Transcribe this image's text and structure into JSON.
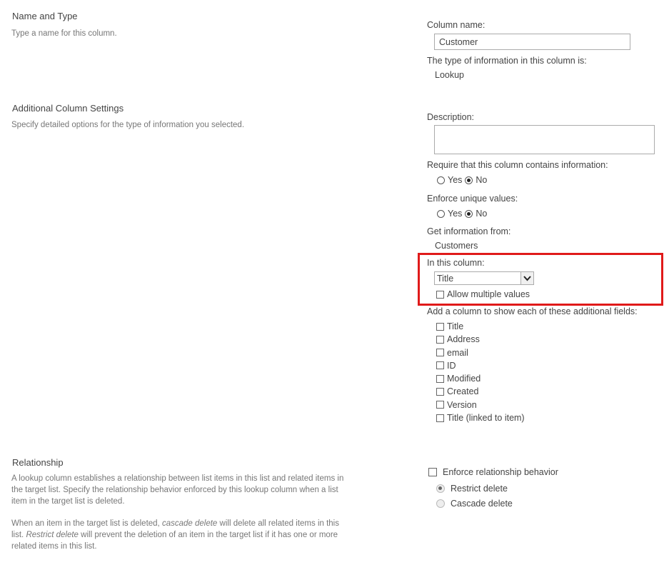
{
  "sections": {
    "name_type": {
      "title": "Name and Type",
      "description": "Type a name for this column."
    },
    "additional": {
      "title": "Additional Column Settings",
      "description": "Specify detailed options for the type of information you selected."
    },
    "relationship": {
      "title": "Relationship",
      "description_p1": "A lookup column establishes a relationship between list items in this list and related items in the target list. Specify the relationship behavior enforced by this lookup column when a list item in the target list is deleted.",
      "description_p2_a": "When an item in the target list is deleted, ",
      "description_p2_b": "cascade delete",
      "description_p2_c": " will delete all related items in this list. ",
      "description_p2_d": "Restrict delete",
      "description_p2_e": " will prevent the deletion of an item in the target list if it has one or more related items in this list."
    }
  },
  "form": {
    "column_name_label": "Column name:",
    "column_name_value": "Customer",
    "type_label": "The type of information in this column is:",
    "type_value": "Lookup",
    "description_label": "Description:",
    "description_value": "",
    "require_label": "Require that this column contains information:",
    "require_options": [
      {
        "label": "Yes",
        "checked": false
      },
      {
        "label": "No",
        "checked": true
      }
    ],
    "unique_label": "Enforce unique values:",
    "unique_options": [
      {
        "label": "Yes",
        "checked": false
      },
      {
        "label": "No",
        "checked": true
      }
    ],
    "source_label": "Get information from:",
    "source_value": "Customers",
    "in_column_label": "In this column:",
    "in_column_selected": "Title",
    "allow_multiple_label": "Allow multiple values",
    "allow_multiple_checked": false,
    "additional_fields_label": "Add a column to show each of these additional fields:",
    "additional_fields": [
      {
        "label": "Title",
        "checked": false
      },
      {
        "label": "Address",
        "checked": false
      },
      {
        "label": "email",
        "checked": false
      },
      {
        "label": "ID",
        "checked": false
      },
      {
        "label": "Modified",
        "checked": false
      },
      {
        "label": "Created",
        "checked": false
      },
      {
        "label": "Version",
        "checked": false
      },
      {
        "label": "Title (linked to item)",
        "checked": false
      }
    ],
    "enforce_relationship_label": "Enforce relationship behavior",
    "enforce_relationship_checked": false,
    "relationship_options": [
      {
        "label": "Restrict delete",
        "checked": true,
        "disabled": true
      },
      {
        "label": "Cascade delete",
        "checked": false,
        "disabled": true
      }
    ]
  },
  "colors": {
    "highlight": "#e01a1a"
  }
}
